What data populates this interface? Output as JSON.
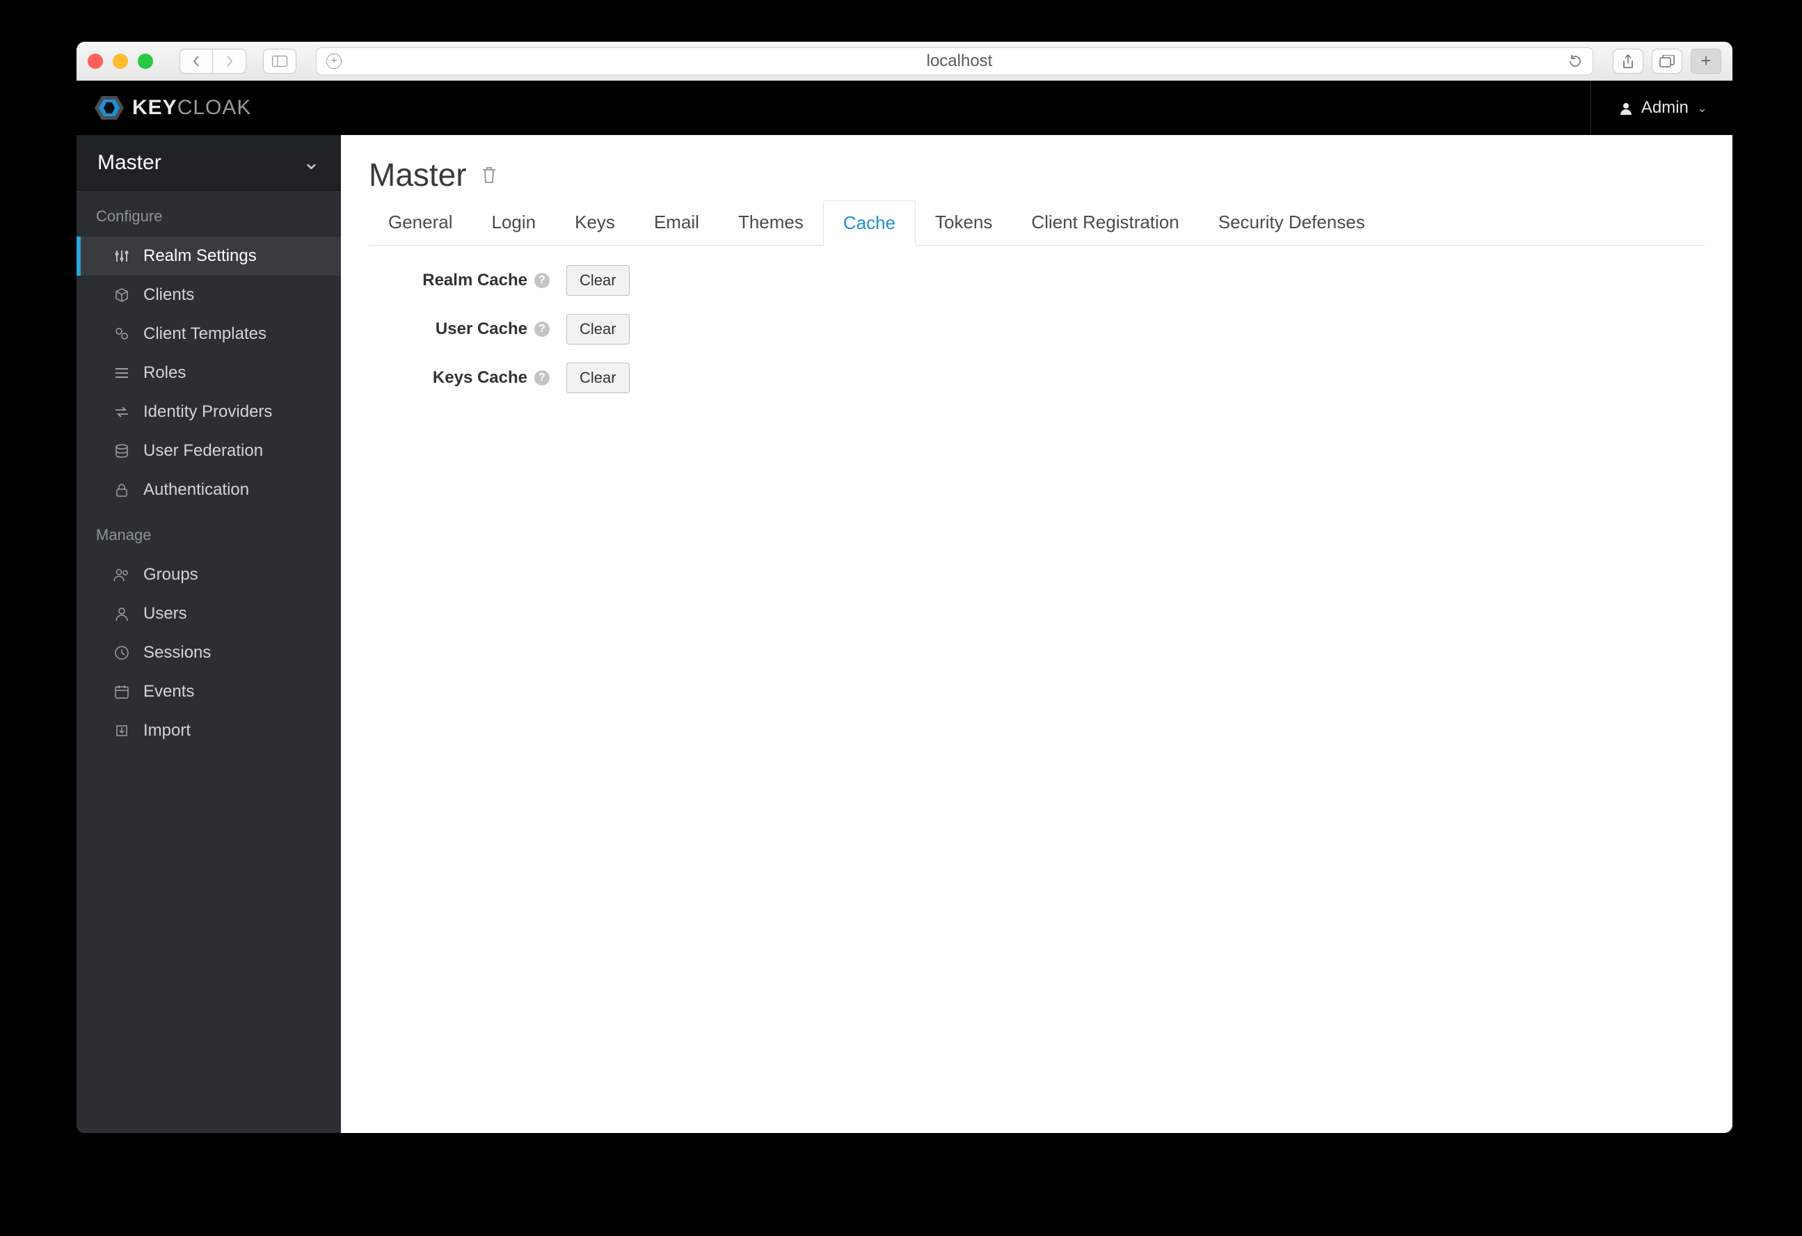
{
  "browser": {
    "host": "localhost"
  },
  "brand": {
    "bold": "KEY",
    "light": "CLOAK"
  },
  "user": {
    "name": "Admin"
  },
  "realm_switch": {
    "label": "Master"
  },
  "sidebar": {
    "configure_label": "Configure",
    "manage_label": "Manage",
    "configure": [
      {
        "label": "Realm Settings"
      },
      {
        "label": "Clients"
      },
      {
        "label": "Client Templates"
      },
      {
        "label": "Roles"
      },
      {
        "label": "Identity Providers"
      },
      {
        "label": "User Federation"
      },
      {
        "label": "Authentication"
      }
    ],
    "manage": [
      {
        "label": "Groups"
      },
      {
        "label": "Users"
      },
      {
        "label": "Sessions"
      },
      {
        "label": "Events"
      },
      {
        "label": "Import"
      }
    ]
  },
  "page": {
    "title": "Master",
    "tabs": [
      {
        "label": "General"
      },
      {
        "label": "Login"
      },
      {
        "label": "Keys"
      },
      {
        "label": "Email"
      },
      {
        "label": "Themes"
      },
      {
        "label": "Cache"
      },
      {
        "label": "Tokens"
      },
      {
        "label": "Client Registration"
      },
      {
        "label": "Security Defenses"
      }
    ],
    "active_tab": "Cache",
    "cache_rows": [
      {
        "label": "Realm Cache",
        "button": "Clear"
      },
      {
        "label": "User Cache",
        "button": "Clear"
      },
      {
        "label": "Keys Cache",
        "button": "Clear"
      }
    ]
  }
}
